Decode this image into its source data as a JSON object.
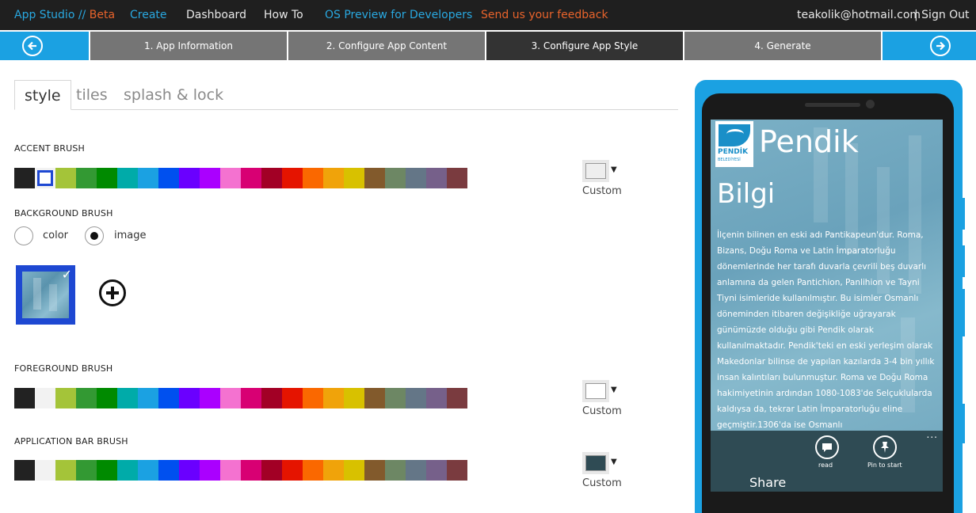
{
  "topnav": {
    "brand": "App Studio //",
    "brand_beta": " Beta",
    "create": "Create",
    "dashboard": "Dashboard",
    "howto": "How To",
    "preview": "OS Preview for Developers",
    "feedback": "Send us your feedback",
    "email": "teakolik@hotmail.com",
    "signout": "| Sign Out"
  },
  "wizard": {
    "steps": [
      {
        "label": "1. App Information"
      },
      {
        "label": "2. Configure App Content"
      },
      {
        "label": "3. Configure App Style"
      },
      {
        "label": "4. Generate"
      }
    ],
    "active_step": 3
  },
  "tabs": {
    "style": "style",
    "tiles": "tiles",
    "splash": "splash & lock"
  },
  "palette": [
    "#222222",
    "#f2f2f2",
    "#a4c439",
    "#339933",
    "#008a00",
    "#00aba9",
    "#1ba1e2",
    "#0050ef",
    "#6a00ff",
    "#aa00ff",
    "#f472d0",
    "#d80073",
    "#a20025",
    "#e51400",
    "#fa6800",
    "#f0a30a",
    "#d8c100",
    "#825a2c",
    "#6d8764",
    "#647687",
    "#76608a",
    "#7a3b3f"
  ],
  "accent": {
    "label": "ACCENT BRUSH",
    "custom_label": "Custom",
    "custom_color": "#eeeeee",
    "selected_index": 1
  },
  "background": {
    "label": "BACKGROUND BRUSH",
    "option_color": "color",
    "option_image": "image",
    "selected": "image"
  },
  "foreground": {
    "label": "FOREGROUND BRUSH",
    "custom_label": "Custom",
    "custom_color": "#ffffff"
  },
  "appbar_brush": {
    "label": "APPLICATION BAR BRUSH",
    "custom_label": "Custom",
    "custom_color": "#2f4b54"
  },
  "icons": {
    "back": "left-arrow-circle-icon",
    "next": "right-arrow-circle-icon",
    "add": "plus-circle-icon",
    "check": "checkmark-icon",
    "read": "chat-bubble-icon",
    "pin": "pin-icon",
    "more": "ellipsis-icon"
  },
  "preview": {
    "app_title": "Pendik",
    "logo_line1": "PENDİK",
    "logo_line2": "BELEDİYESİ",
    "page_title": "Bilgi",
    "body": "İlçenin bilinen en eski adı Pantikapeun'dur. Roma, Bizans, Doğu Roma ve Latin İmparatorluğu dönemlerinde her tarafı duvarla çevrili beş duvarlı anlamına da gelen Pantichion, Panlihion ve Tayni Tiyni isimleride kullanılmıştır. Bu isimler Osmanlı döneminden itibaren değişikliğe uğrayarak günümüzde olduğu gibi Pendik olarak kullanılmaktadır. Pendik'teki en eski yerleşim olarak Makedonlar bilinse de yapılan kazılarda 3-4 bin yıllık insan kalıntıları bulunmuştur. Roma ve Doğu Roma hakimiyetinin ardından 1080-1083'de Selçuklularda kaldıysa da, tekrar Latin İmparatorluğu eline geçmiştir.1306'da ise Osmanlı",
    "appbar_more": "...",
    "btn_read": "read",
    "btn_pin": "Pin to start",
    "share": "Share"
  }
}
